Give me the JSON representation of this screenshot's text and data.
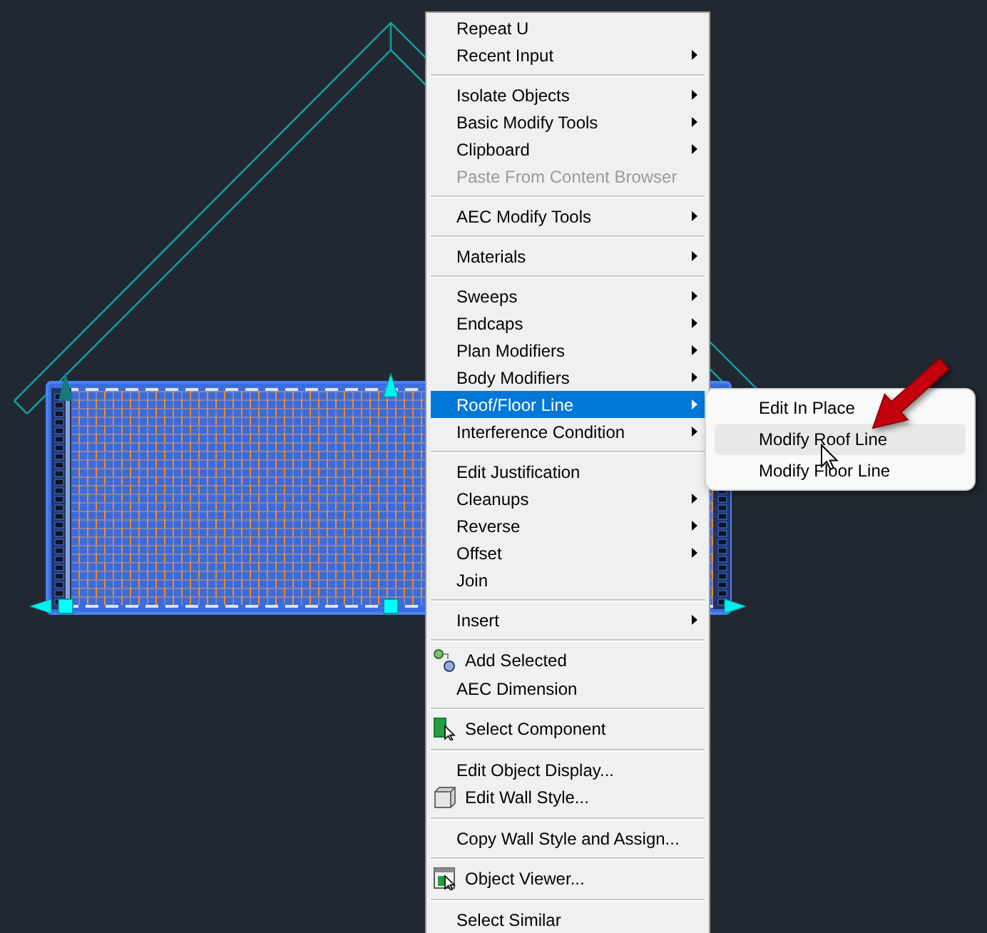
{
  "context_menu": {
    "items": [
      {
        "kind": "item",
        "label": "Repeat U",
        "submenu": false,
        "disabled": false,
        "selected": false
      },
      {
        "kind": "item",
        "label": "Recent Input",
        "submenu": true,
        "disabled": false,
        "selected": false
      },
      {
        "kind": "separator"
      },
      {
        "kind": "item",
        "label": "Isolate Objects",
        "submenu": true,
        "disabled": false,
        "selected": false
      },
      {
        "kind": "item",
        "label": "Basic Modify Tools",
        "submenu": true,
        "disabled": false,
        "selected": false
      },
      {
        "kind": "item",
        "label": "Clipboard",
        "submenu": true,
        "disabled": false,
        "selected": false
      },
      {
        "kind": "item",
        "label": "Paste From Content Browser",
        "submenu": false,
        "disabled": true,
        "selected": false
      },
      {
        "kind": "separator"
      },
      {
        "kind": "item",
        "label": "AEC Modify Tools",
        "submenu": true,
        "disabled": false,
        "selected": false
      },
      {
        "kind": "separator"
      },
      {
        "kind": "item",
        "label": "Materials",
        "submenu": true,
        "disabled": false,
        "selected": false
      },
      {
        "kind": "separator"
      },
      {
        "kind": "item",
        "label": "Sweeps",
        "submenu": true,
        "disabled": false,
        "selected": false
      },
      {
        "kind": "item",
        "label": "Endcaps",
        "submenu": true,
        "disabled": false,
        "selected": false
      },
      {
        "kind": "item",
        "label": "Plan Modifiers",
        "submenu": true,
        "disabled": false,
        "selected": false
      },
      {
        "kind": "item",
        "label": "Body Modifiers",
        "submenu": true,
        "disabled": false,
        "selected": false
      },
      {
        "kind": "item",
        "label": "Roof/Floor Line",
        "submenu": true,
        "disabled": false,
        "selected": true
      },
      {
        "kind": "item",
        "label": "Interference Condition",
        "submenu": true,
        "disabled": false,
        "selected": false
      },
      {
        "kind": "separator"
      },
      {
        "kind": "item",
        "label": "Edit Justification",
        "submenu": false,
        "disabled": false,
        "selected": false
      },
      {
        "kind": "item",
        "label": "Cleanups",
        "submenu": true,
        "disabled": false,
        "selected": false
      },
      {
        "kind": "item",
        "label": "Reverse",
        "submenu": true,
        "disabled": false,
        "selected": false
      },
      {
        "kind": "item",
        "label": "Offset",
        "submenu": true,
        "disabled": false,
        "selected": false
      },
      {
        "kind": "item",
        "label": "Join",
        "submenu": false,
        "disabled": false,
        "selected": false
      },
      {
        "kind": "separator"
      },
      {
        "kind": "item",
        "label": "Insert",
        "submenu": true,
        "disabled": false,
        "selected": false
      },
      {
        "kind": "separator"
      },
      {
        "kind": "icon_item",
        "label": "Add Selected",
        "submenu": false,
        "disabled": false,
        "selected": false
      },
      {
        "kind": "item",
        "label": "AEC Dimension",
        "submenu": false,
        "disabled": false,
        "selected": false
      },
      {
        "kind": "separator"
      },
      {
        "kind": "icon_item",
        "label": "Select Component",
        "submenu": false,
        "disabled": false,
        "selected": false
      },
      {
        "kind": "separator"
      },
      {
        "kind": "item",
        "label": "Edit Object Display...",
        "submenu": false,
        "disabled": false,
        "selected": false
      },
      {
        "kind": "icon_item",
        "label": "Edit Wall Style...",
        "submenu": false,
        "disabled": false,
        "selected": false
      },
      {
        "kind": "separator"
      },
      {
        "kind": "item",
        "label": "Copy Wall Style and Assign...",
        "submenu": false,
        "disabled": false,
        "selected": false
      },
      {
        "kind": "separator"
      },
      {
        "kind": "icon_item",
        "label": "Object Viewer...",
        "submenu": false,
        "disabled": false,
        "selected": false
      },
      {
        "kind": "separator"
      },
      {
        "kind": "item",
        "label": "Select Similar",
        "submenu": false,
        "disabled": false,
        "selected": false
      }
    ]
  },
  "submenu": {
    "items": [
      {
        "label": "Edit In Place",
        "selected": false
      },
      {
        "label": "Modify Roof Line",
        "selected": true
      },
      {
        "label": "Modify Floor Line",
        "selected": false
      }
    ]
  }
}
